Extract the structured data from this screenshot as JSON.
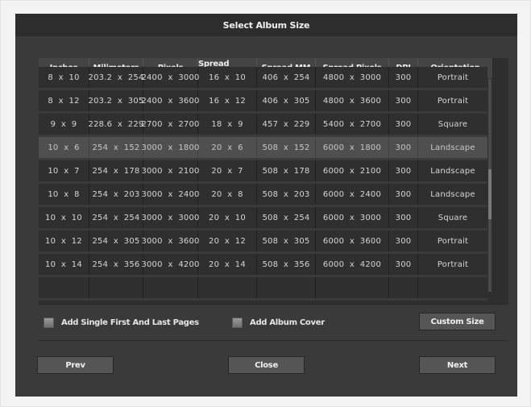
{
  "dialog": {
    "title": "Select Album Size"
  },
  "table": {
    "headers": [
      "Inches",
      "Milimeters",
      "Pixels",
      "Spread Inches",
      "Spread MM",
      "Spread Pixels",
      "DPI",
      "Orientation"
    ],
    "rows": [
      {
        "cells": [
          "8  x  10",
          "203.2  x  254",
          "2400  x  3000",
          "16  x  10",
          "406  x  254",
          "4800  x  3000",
          "300",
          "Portrait"
        ],
        "selected": false
      },
      {
        "cells": [
          "8  x  12",
          "203.2  x  305",
          "2400  x  3600",
          "16  x  12",
          "406  x  305",
          "4800  x  3600",
          "300",
          "Portrait"
        ],
        "selected": false
      },
      {
        "cells": [
          "9  x  9",
          "228.6  x  229",
          "2700  x  2700",
          "18  x  9",
          "457  x  229",
          "5400  x  2700",
          "300",
          "Square"
        ],
        "selected": false
      },
      {
        "cells": [
          "10  x  6",
          "254  x  152",
          "3000  x  1800",
          "20  x  6",
          "508  x  152",
          "6000  x  1800",
          "300",
          "Landscape"
        ],
        "selected": true
      },
      {
        "cells": [
          "10  x  7",
          "254  x  178",
          "3000  x  2100",
          "20  x  7",
          "508  x  178",
          "6000  x  2100",
          "300",
          "Landscape"
        ],
        "selected": false
      },
      {
        "cells": [
          "10  x  8",
          "254  x  203",
          "3000  x  2400",
          "20  x  8",
          "508  x  203",
          "6000  x  2400",
          "300",
          "Landscape"
        ],
        "selected": false
      },
      {
        "cells": [
          "10  x  10",
          "254  x  254",
          "3000  x  3000",
          "20  x  10",
          "508  x  254",
          "6000  x  3000",
          "300",
          "Square"
        ],
        "selected": false
      },
      {
        "cells": [
          "10  x  12",
          "254  x  305",
          "3000  x  3600",
          "20  x  12",
          "508  x  305",
          "6000  x  3600",
          "300",
          "Portrait"
        ],
        "selected": false
      },
      {
        "cells": [
          "10  x  14",
          "254  x  356",
          "3000  x  4200",
          "20  x  14",
          "508  x  356",
          "6000  x  4200",
          "300",
          "Portrait"
        ],
        "selected": false
      },
      {
        "cells": [
          "",
          "",
          "",
          "",
          "",
          "",
          "",
          ""
        ],
        "selected": false
      }
    ]
  },
  "options": {
    "single_first_last_label": "Add Single First And Last Pages",
    "single_first_last_checked": false,
    "album_cover_label": "Add Album Cover",
    "album_cover_checked": false,
    "custom_size_label": "Custom Size"
  },
  "footer": {
    "prev_label": "Prev",
    "close_label": "Close",
    "next_label": "Next"
  }
}
